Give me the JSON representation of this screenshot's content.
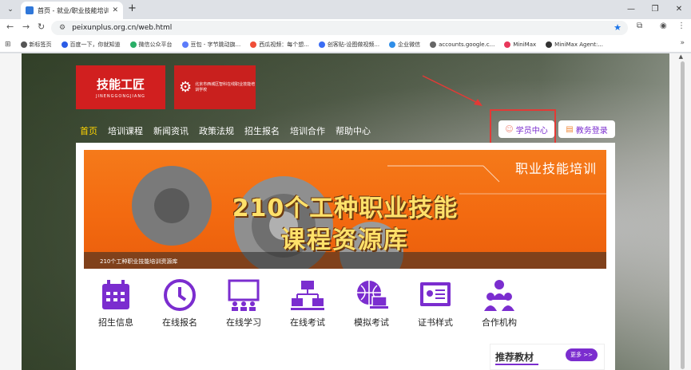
{
  "browser": {
    "tab_title": "首页 - 就业/职业技能培训课程",
    "url": "peixunplus.org.cn/web.html",
    "bookmarks": [
      {
        "label": "新标签页",
        "color": "#555555"
      },
      {
        "label": "百度一下，你就知道",
        "color": "#2b5ce6"
      },
      {
        "label": "微信公众平台",
        "color": "#2aae67"
      },
      {
        "label": "豆包 - 字节跳动旗...",
        "color": "#5c7cfa"
      },
      {
        "label": "西瓜视频：每个想...",
        "color": "#f04e37"
      },
      {
        "label": "创客贴-设图做视频...",
        "color": "#3a6cf4"
      },
      {
        "label": "企业微信",
        "color": "#2f8ee8"
      },
      {
        "label": "accounts.google.c...",
        "color": "#666666"
      },
      {
        "label": "MiniMax",
        "color": "#e8385b"
      },
      {
        "label": "MiniMax Agent:...",
        "color": "#333333"
      }
    ]
  },
  "site": {
    "logo1_main": "技能工匠",
    "logo1_sub": "JINENGGONGJIANG",
    "logo2_text": "北京市西城区智科在线职业技能培训学校",
    "nav": [
      "首页",
      "培训课程",
      "新闻资讯",
      "政策法规",
      "招生报名",
      "培训合作",
      "帮助中心"
    ],
    "student_center": "学员中心",
    "admin_login": "教务登录",
    "banner": {
      "slogan": "职业技能培训",
      "headline1": "210个工种职业技能",
      "headline2": "课程资源库",
      "caption": "210个工种职业技能培训资源库"
    },
    "services": [
      {
        "label": "招生信息",
        "icon": "calendar-icon"
      },
      {
        "label": "在线报名",
        "icon": "clock-icon"
      },
      {
        "label": "在线学习",
        "icon": "classroom-icon"
      },
      {
        "label": "在线考试",
        "icon": "network-icon"
      },
      {
        "label": "模拟考试",
        "icon": "globe-laptop-icon"
      },
      {
        "label": "证书样式",
        "icon": "certificate-icon"
      },
      {
        "label": "合作机构",
        "icon": "people-icon"
      }
    ],
    "recommended_title": "推荐教材",
    "more_label": "更多 >>"
  },
  "colors": {
    "accent": "#7b2dcf",
    "brand_red": "#d11f1f",
    "banner_orange": "#f36a10",
    "nav_active": "#ffd400",
    "highlight": "#e23a36"
  }
}
